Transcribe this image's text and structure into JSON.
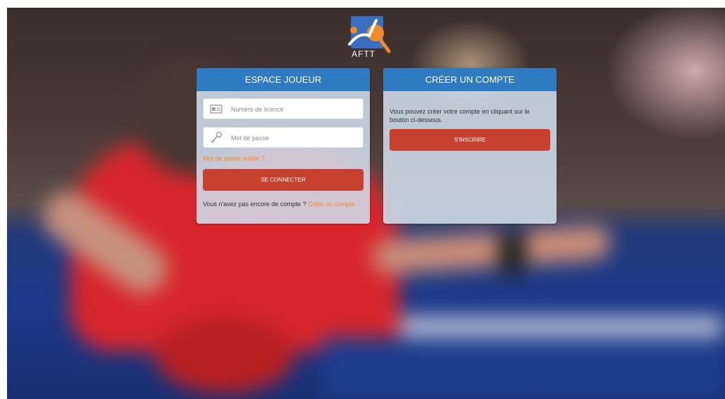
{
  "logo": {
    "text": "AFTT",
    "icon": "table-tennis-logo-icon"
  },
  "colors": {
    "accent_blue": "#2e7bc2",
    "button_red": "#c8412f",
    "link_orange": "#f08a2b"
  },
  "login_card": {
    "title": "ESPACE JOUEUR",
    "license_placeholder": "Numéro de licence",
    "password_placeholder": "Mot de passe",
    "forgot_password": "Mot de passe oublié ?",
    "login_button": "SE CONNECTER",
    "no_account_text": "Vous n'avez pas encore de compte ?",
    "create_account_link": "Créer un compte"
  },
  "register_card": {
    "title": "CRÉER UN COMPTE",
    "description": "Vous pouvez créer votre compte en cliquant sur le bouton ci-dessous.",
    "register_button": "S'INSCRIRE"
  }
}
